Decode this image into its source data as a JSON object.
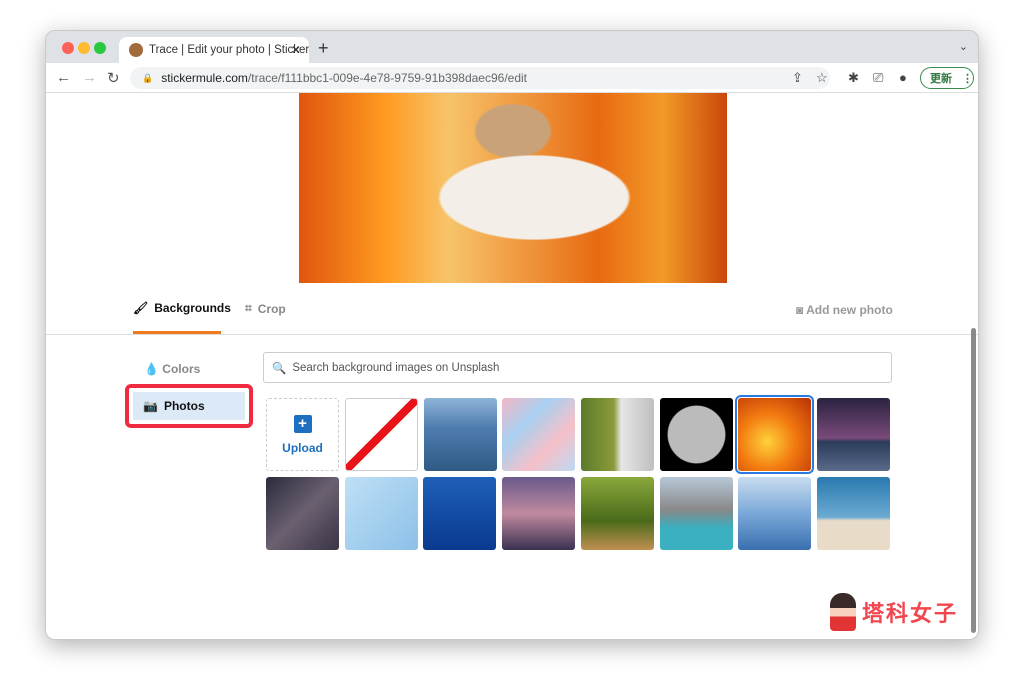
{
  "browser": {
    "tab_title": "Trace | Edit your photo | Sticker",
    "url_domain": "stickermule.com",
    "url_path": "/trace/f111bbc1-009e-4e78-9759-91b398daec96/edit",
    "update_label": "更新"
  },
  "editor": {
    "tabs": [
      {
        "label": "Backgrounds",
        "icon": "brush-icon",
        "active": true
      },
      {
        "label": "Crop",
        "icon": "crop-icon"
      }
    ],
    "add_photo": "Add new photo",
    "accent": "#f07a1c"
  },
  "sidebar": {
    "items": [
      {
        "label": "Colors",
        "icon": "drop-icon"
      },
      {
        "label": "Photos",
        "icon": "camera-icon",
        "active": true
      }
    ]
  },
  "search": {
    "placeholder": "Search background images on Unsplash"
  },
  "grid": {
    "upload_label": "Upload",
    "photos": [
      "city skyline",
      "pink blue marble",
      "waterfall",
      "full moon",
      "fire",
      "milky way lake",
      "milky way sky",
      "confetti",
      "underwater",
      "venice canal",
      "forest path",
      "mountain lake",
      "misty mountains",
      "desert trees"
    ],
    "selected": "fire"
  },
  "watermark": "塔科女子"
}
